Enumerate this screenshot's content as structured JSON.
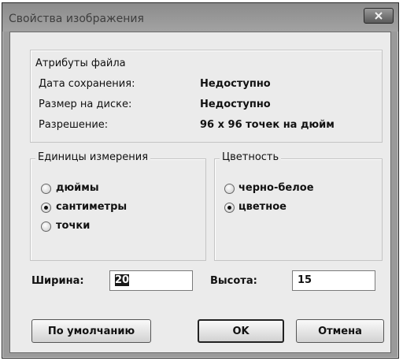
{
  "window": {
    "title": "Свойства изображения",
    "close_icon": "close-icon"
  },
  "file_attributes": {
    "heading": "Атрибуты файла",
    "rows": [
      {
        "label": "Дата сохранения:",
        "value": "Недоступно"
      },
      {
        "label": "Размер на диске:",
        "value": "Недоступно"
      },
      {
        "label": "Разрешение:",
        "value": "96 x 96 точек на дюйм"
      }
    ]
  },
  "units": {
    "heading": "Единицы измерения",
    "options": [
      {
        "label": "дюймы",
        "checked": false
      },
      {
        "label": "сантиметры",
        "checked": true
      },
      {
        "label": "точки",
        "checked": false
      }
    ]
  },
  "color": {
    "heading": "Цветность",
    "options": [
      {
        "label": "черно-белое",
        "checked": false
      },
      {
        "label": "цветное",
        "checked": true
      }
    ]
  },
  "size": {
    "width_label": "Ширина:",
    "width_value": "20",
    "height_label": "Высота:",
    "height_value": "15"
  },
  "buttons": {
    "defaults": "По умолчанию",
    "ok": "OK",
    "cancel": "Отмена"
  }
}
